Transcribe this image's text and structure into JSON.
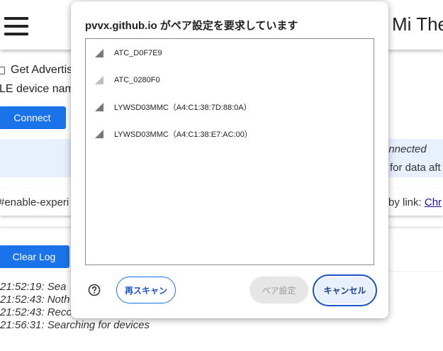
{
  "page": {
    "title": "Mi The",
    "adv_label": "Get Advertis",
    "ble_label": "LE device nam",
    "connect_label": "Connect",
    "status_line1": "onnected",
    "status_line2": "for data aft",
    "flag_text": "#enable-experi",
    "copy_prefix": "by link: ",
    "copy_link": "Chr",
    "clear_log_label": "Clear Log",
    "log": [
      "21:52:19: Sea",
      "21:52:43: Noth",
      "21:52:43: Reco",
      "21:56:31: Searching for devices"
    ]
  },
  "dialog": {
    "title": "pvvx.github.io がペア設定を要求しています",
    "devices": [
      {
        "name": "ATC_D0F7E9",
        "signal_icon": "signal-strength-icon",
        "signal_color": "#777777"
      },
      {
        "name": "ATC_0280F0",
        "signal_icon": "signal-strength-icon",
        "signal_color": "#bdbdbd"
      },
      {
        "name": "LYWSD03MMC（A4:C1:38:7D:88:0A）",
        "signal_icon": "signal-strength-icon",
        "signal_color": "#777777"
      },
      {
        "name": "LYWSD03MMC（A4:C1:38:E7:AC:00）",
        "signal_icon": "signal-strength-icon",
        "signal_color": "#777777"
      }
    ],
    "help_icon": "help-circle-icon",
    "rescan_label": "再スキャン",
    "pair_label": "ペア設定",
    "cancel_label": "キャンセル"
  }
}
